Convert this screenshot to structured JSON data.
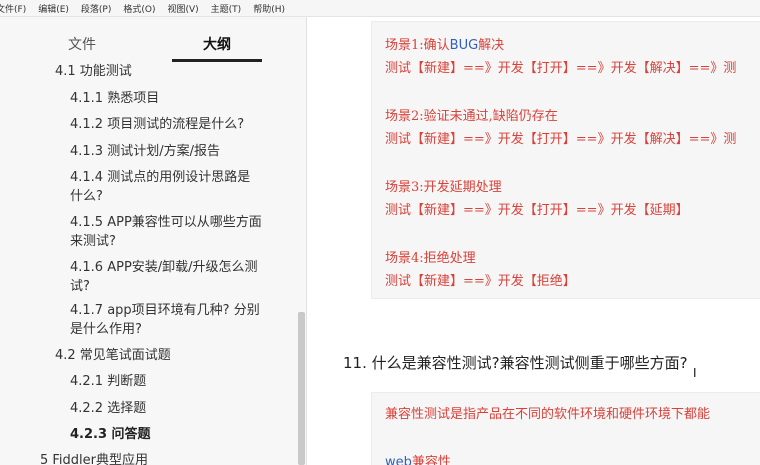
{
  "menubar": {
    "items": [
      "文件(F)",
      "编辑(E)",
      "段落(P)",
      "格式(O)",
      "视图(V)",
      "主题(T)",
      "帮助(H)"
    ]
  },
  "sidebar": {
    "tabs": {
      "files": "文件",
      "outline": "大纲"
    },
    "items": [
      {
        "text": "4.1 功能测试"
      },
      {
        "text": "4.1.1 熟悉项目"
      },
      {
        "text": "4.1.2 项目测试的流程是什么?"
      },
      {
        "text": "4.1.3 测试计划/方案/报告"
      },
      {
        "text": "4.1.4 测试点的用例设计思路是"
      },
      {
        "text": "什么?"
      },
      {
        "text": "4.1.5 APP兼容性可以从哪些方面"
      },
      {
        "text": "来测试?"
      },
      {
        "text": "4.1.6 APP安装/卸载/升级怎么测"
      },
      {
        "text": "试?"
      },
      {
        "text": "4.1.7 app项目环境有几种? 分别"
      },
      {
        "text": "是什么作用?"
      },
      {
        "text": "4.2 常见笔试面试题"
      },
      {
        "text": "4.2.1 判断题"
      },
      {
        "text": "4.2.2 选择题"
      },
      {
        "text": "4.2.3 问答题"
      },
      {
        "text": "5 Fiddler典型应用"
      }
    ]
  },
  "content": {
    "block1": {
      "scene1_title_a": "场景1:确认",
      "scene1_title_b": "BUG",
      "scene1_title_c": "解决",
      "scene1_flow": "测试【新建】==》开发【打开】==》开发【解决】==》测",
      "scene2_title": "场景2:验证未通过,缺陷仍存在",
      "scene2_flow": "测试【新建】==》开发【打开】==》开发【解决】==》测",
      "scene3_title": "场景3:开发延期处理",
      "scene3_flow": "测试【新建】==》开发【打开】==》开发【延期】",
      "scene4_title": "场景4:拒绝处理",
      "scene4_flow": "测试【新建】==》开发【拒绝】"
    },
    "heading": "11. 什么是兼容性测试?兼容性测试侧重于哪些方面?",
    "block2": {
      "line1": "兼容性测试是指产品在不同的软件环境和硬件环境下都能",
      "line2_a": "web",
      "line2_b": "兼容性"
    },
    "cursor_glyph": "I"
  },
  "colors": {
    "code_text": "#d9423a",
    "code_keyword": "#2f5fbf",
    "code_bg": "#f6f6f6"
  }
}
